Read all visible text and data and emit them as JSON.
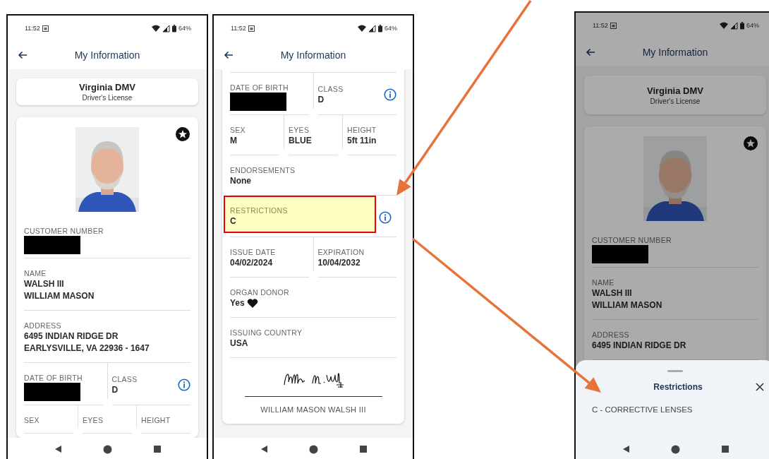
{
  "phones": [
    {
      "status_bar": {
        "time": "11:52",
        "battery": "64%"
      },
      "title": "My Information",
      "issuer": {
        "name": "Virginia DMV",
        "document": "Driver's License"
      },
      "card": {
        "favorite": true,
        "photo": {
          "kind": "picture"
        },
        "rows": [
          [
            {
              "label": "CUSTOMER NUMBER",
              "redacted": true
            }
          ],
          [
            {
              "label": "NAME",
              "lines": [
                "WALSH III",
                "WILLIAM MASON"
              ]
            }
          ],
          [
            {
              "label": "ADDRESS",
              "lines": [
                "6495 INDIAN RIDGE DR",
                "EARLYSVILLE, VA 22936 - 1647"
              ]
            }
          ],
          [
            {
              "label": "DATE OF BIRTH",
              "redacted": true
            },
            {
              "label": "CLASS",
              "lines": [
                "D"
              ],
              "info": true
            }
          ],
          [
            {
              "label": "SEX"
            },
            {
              "label": "EYES"
            },
            {
              "label": "HEIGHT"
            }
          ]
        ]
      }
    },
    {
      "status_bar": {
        "time": "11:52",
        "battery": "64%"
      },
      "title": "My Information",
      "card": {
        "cut_top": true,
        "rows": [
          [
            {
              "label": "DATE OF BIRTH",
              "redacted": true
            },
            {
              "label": "CLASS",
              "lines": [
                "D"
              ],
              "info": true
            }
          ],
          [
            {
              "label": "SEX",
              "lines": [
                "M"
              ]
            },
            {
              "label": "EYES",
              "lines": [
                "BLUE"
              ]
            },
            {
              "label": "HEIGHT",
              "lines": [
                "5ft 11in"
              ]
            }
          ],
          [
            {
              "label": "ENDORSEMENTS",
              "lines": [
                "None"
              ]
            }
          ],
          [
            {
              "label": "RESTRICTIONS",
              "lines": [
                "C"
              ],
              "info": true,
              "highlighted": true
            }
          ],
          [
            {
              "label": "ISSUE DATE",
              "lines": [
                "04/02/2024"
              ]
            },
            {
              "label": "EXPIRATION",
              "lines": [
                "10/04/2032"
              ]
            }
          ],
          [
            {
              "label": "ORGAN DONOR",
              "lines": [
                "Yes"
              ],
              "heart": true
            }
          ],
          [
            {
              "label": "ISSUING COUNTRY",
              "lines": [
                "USA"
              ]
            }
          ]
        ],
        "signature": {
          "caption": "WILLIAM MASON WALSH III"
        }
      }
    },
    {
      "status_bar": {
        "time": "11:52",
        "battery": "64%"
      },
      "title": "My Information",
      "issuer": {
        "name": "Virginia DMV",
        "document": "Driver's License"
      },
      "dimmed": true,
      "card": {
        "favorite": true,
        "photo": {
          "kind": "picture"
        },
        "rows": [
          [
            {
              "label": "CUSTOMER NUMBER",
              "redacted": true
            }
          ],
          [
            {
              "label": "NAME",
              "lines": [
                "WALSH III",
                "WILLIAM MASON"
              ]
            }
          ],
          [
            {
              "label": "ADDRESS",
              "lines": [
                "6495 INDIAN RIDGE DR"
              ]
            }
          ]
        ]
      },
      "sheet": {
        "title": "Restrictions",
        "text": "C - CORRECTIVE LENSES"
      }
    }
  ]
}
